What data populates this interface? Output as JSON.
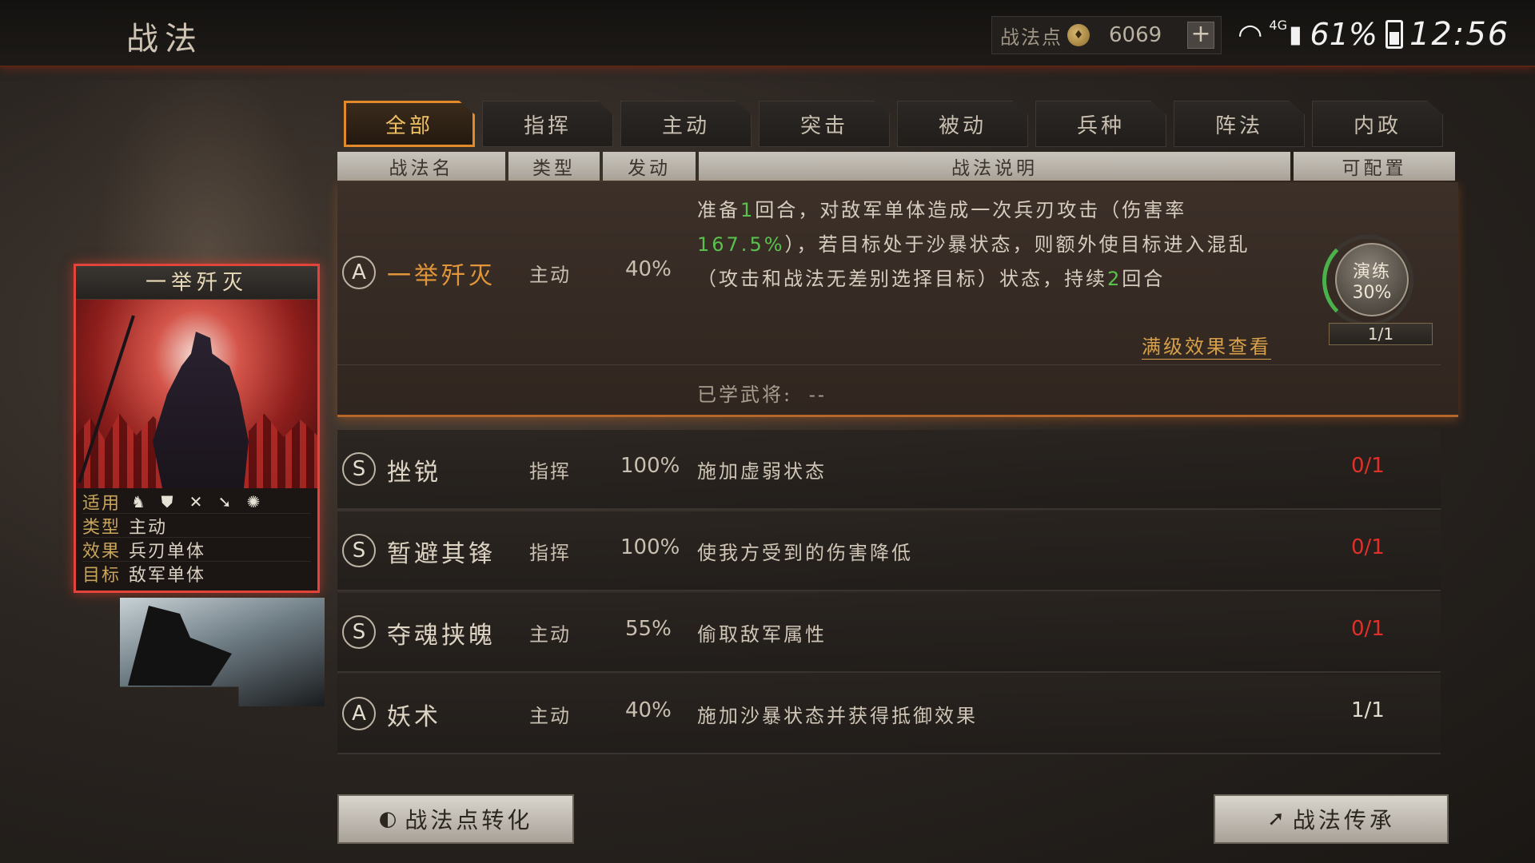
{
  "header": {
    "title": "战法",
    "points_label": "战法点",
    "points_value": "6069",
    "plus": "+"
  },
  "status_bar": {
    "network": "4G",
    "battery": "61%",
    "time": "12:56"
  },
  "tabs": [
    {
      "label": "全部",
      "active": true
    },
    {
      "label": "指挥",
      "active": false
    },
    {
      "label": "主动",
      "active": false
    },
    {
      "label": "突击",
      "active": false
    },
    {
      "label": "被动",
      "active": false
    },
    {
      "label": "兵种",
      "active": false
    },
    {
      "label": "阵法",
      "active": false
    },
    {
      "label": "内政",
      "active": false
    }
  ],
  "columns": [
    "战法名",
    "类型",
    "发动",
    "战法说明",
    "可配置"
  ],
  "card": {
    "title": "一举歼灭",
    "rows": [
      {
        "key": "适用",
        "value": ""
      },
      {
        "key": "类型",
        "value": "主动"
      },
      {
        "key": "效果",
        "value": "兵刃单体"
      },
      {
        "key": "目标",
        "value": "敌军单体"
      }
    ],
    "troop_icons": [
      "cavalry-icon",
      "shield-icon",
      "archer-icon",
      "spear-icon",
      "siege-icon"
    ]
  },
  "selected_skill": {
    "grade": "A",
    "name": "一举歼灭",
    "type": "主动",
    "rate": "40%",
    "desc_parts": [
      {
        "t": "准备",
        "g": false
      },
      {
        "t": "1",
        "g": true
      },
      {
        "t": "回合，对敌军单体造成一次兵刃攻击（伤害率",
        "g": false
      },
      {
        "t": "167.5%",
        "g": true
      },
      {
        "t": "），若目标处于沙暴状态，则额外使目标进入混乱（攻击和战法无差别选择目标）状态，持续",
        "g": false
      },
      {
        "t": "2",
        "g": true
      },
      {
        "t": "回合",
        "g": false
      }
    ],
    "full_level_link": "满级效果查看",
    "learned_label": "已学武将:",
    "learned_value": "--",
    "train_label": "演练",
    "train_pct": "30%",
    "train_count": "1/1"
  },
  "skills": [
    {
      "grade": "S",
      "name": "挫锐",
      "type": "指挥",
      "rate": "100%",
      "desc": "施加虚弱状态",
      "count": "0/1",
      "count_color": "#e0302a"
    },
    {
      "grade": "S",
      "name": "暂避其锋",
      "type": "指挥",
      "rate": "100%",
      "desc": "使我方受到的伤害降低",
      "count": "0/1",
      "count_color": "#e0302a"
    },
    {
      "grade": "S",
      "name": "夺魂挟魄",
      "type": "主动",
      "rate": "55%",
      "desc": "偷取敌军属性",
      "count": "0/1",
      "count_color": "#e0302a"
    },
    {
      "grade": "A",
      "name": "妖术",
      "type": "主动",
      "rate": "40%",
      "desc": "施加沙暴状态并获得抵御效果",
      "count": "1/1",
      "count_color": "#e4dccd"
    }
  ],
  "buttons": {
    "convert": "战法点转化",
    "inherit": "战法传承"
  },
  "colors": {
    "accent_orange": "#e28a2a",
    "highlight_green": "#59c24e",
    "unavailable_red": "#e0302a",
    "card_border": "#e0443a"
  }
}
